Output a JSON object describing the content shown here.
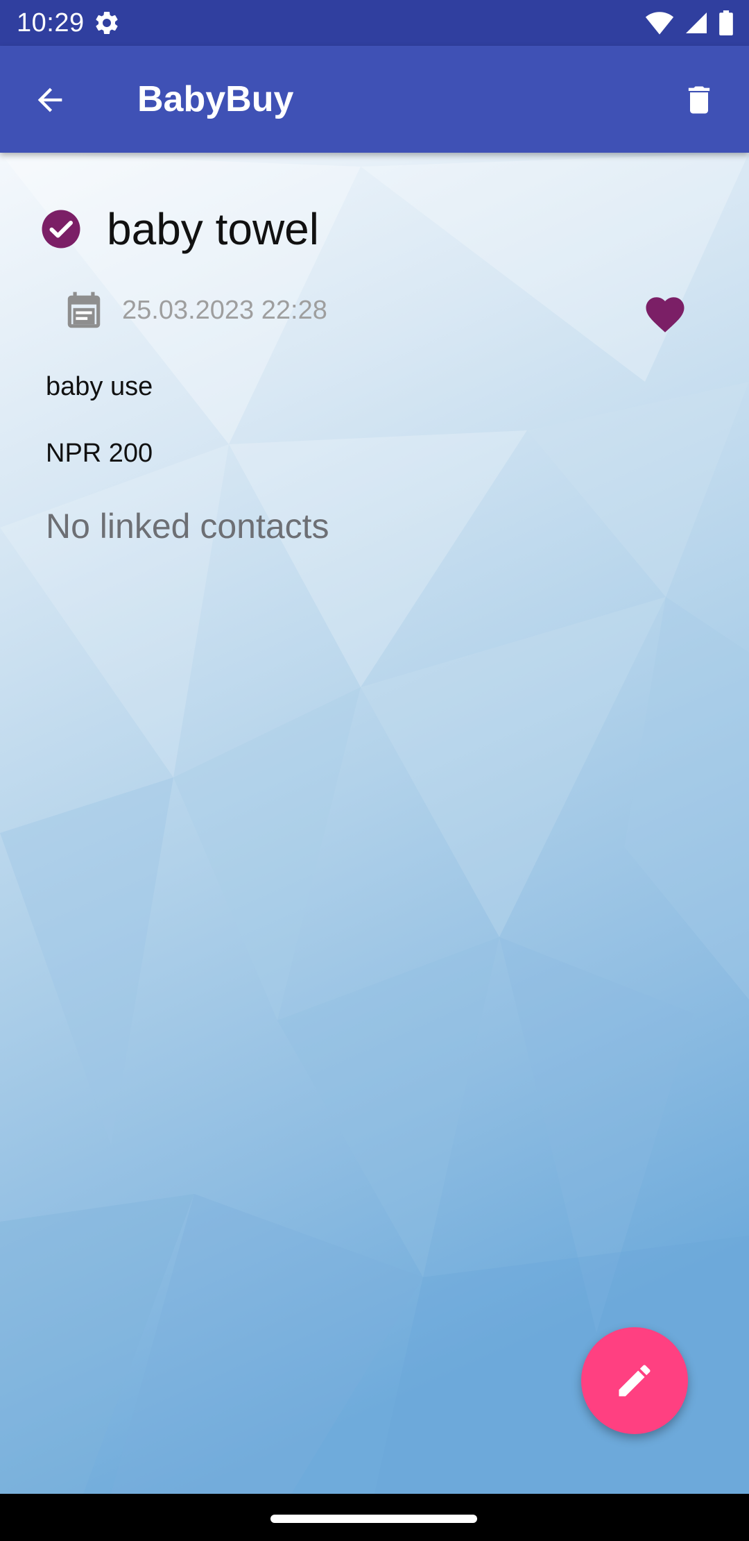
{
  "status_bar": {
    "time": "10:29",
    "icons": [
      "settings-gear-icon",
      "wifi-icon",
      "signal-icon",
      "battery-icon"
    ]
  },
  "app_bar": {
    "title": "BabyBuy",
    "back_icon": "arrow-back-icon",
    "delete_icon": "trash-icon",
    "color": "#3f51b5",
    "status_color": "#303f9f"
  },
  "item": {
    "name": "baby towel",
    "purchased": true,
    "date": "25.03.2023 22:28",
    "favorite": true,
    "description": "baby use",
    "price": "NPR 200",
    "linked_contacts_text": "No linked contacts",
    "accent_color": "#7b1f66"
  },
  "fab": {
    "icon": "pencil-edit-icon",
    "color": "#ff4081"
  }
}
